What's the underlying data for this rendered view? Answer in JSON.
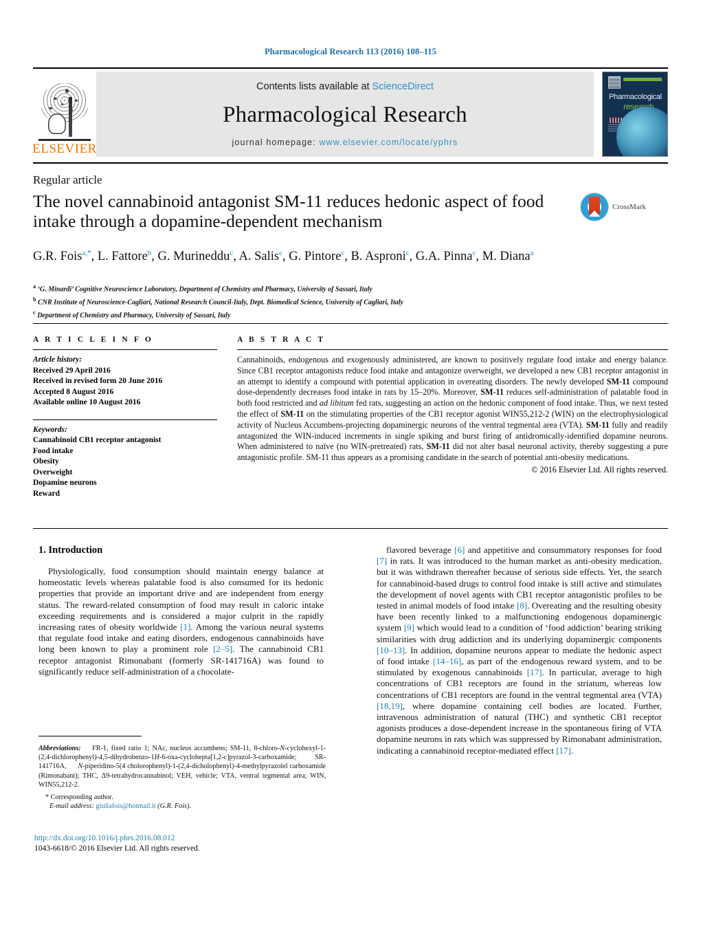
{
  "running_head": "Pharmacological Research 113 (2016) 108–115",
  "masthead": {
    "publisher_name": "ELSEVIER",
    "contents_prefix": "Contents lists available at ",
    "contents_link": "ScienceDirect",
    "journal_title": "Pharmacological Research",
    "homepage_prefix": "journal homepage: ",
    "homepage_url": "www.elsevier.com/locate/yphrs",
    "cover": {
      "line1": "Pharmacological",
      "line2": "research"
    }
  },
  "article": {
    "type": "Regular article",
    "title": "The novel cannabinoid antagonist SM-11 reduces hedonic aspect of food intake through a dopamine-dependent mechanism",
    "crossmark_label": "CrossMark",
    "authors_html": "G.R. Fois<sup>a,*</sup>, L. Fattore<sup>b</sup>, G. Murineddu<sup>c</sup>, A. Salis<sup>c</sup>, G. Pintore<sup>c</sup>, B. Asproni<sup>c</sup>, G.A. Pinna<sup>c</sup>, M. Diana<sup>a</sup>",
    "affiliations": [
      "‘G. Minardi’ Cognitive Neuroscience Laboratory, Department of Chemistry and Pharmacy, University of Sassari, Italy",
      "CNR Institute of Neuroscience-Cagliari, National Research Council-Italy, Dept. Biomedical Science, University of Cagliari, Italy",
      "Department of Chemistry and Pharmacy, University of Sassari, Italy"
    ],
    "affiliation_marks": [
      "a",
      "b",
      "c"
    ]
  },
  "article_info": {
    "heading": "A R T I C L E   I N F O",
    "history_label": "Article history:",
    "history": [
      "Received 29 April 2016",
      "Received in revised form 20 June 2016",
      "Accepted 8 August 2016",
      "Available online 10 August 2016"
    ],
    "keywords_label": "Keywords:",
    "keywords": [
      "Cannabinoid CB1 receptor antagonist",
      "Food intake",
      "Obesity",
      "Overweight",
      "Dopamine neurons",
      "Reward"
    ]
  },
  "abstract": {
    "heading": "A B S T R A C T",
    "body_html": "Cannabinoids, endogenous and exogenously administered, are known to positively regulate food intake and energy balance. Since CB1 receptor antagonists reduce food intake and antagonize overweight, we developed a new CB1 receptor antagonist in an attempt to identify a compound with potential application in overeating disorders. The newly developed <b>SM-11</b> compound dose-dependently decreases food intake in rats by 15&ndash;20%. Moreover, <b>SM-11</b> reduces self-administration of palatable food in both food restricted and <i>ad libitum</i> fed rats, suggesting an action on the hedonic component of food intake. Thus, we next tested the effect of <b>SM-11</b> on the stimulating properties of the CB1 receptor agonist WIN55,212-2 (WIN) on the electrophysiological activity of Nucleus Accumbens-projecting dopaminergic neurons of the ventral tegmental area (VTA). <b>SM-11</b> fully and readily antagonized the WIN-induced increments in single spiking and burst firing of antidromically-identified dopamine neurons. When administered to na&iuml;ve (no WIN-pretreated) rats, <b>SM-11</b> did not alter basal neuronal activity, thereby suggesting a pure antagonistic profile. SM-11 thus appears as a promising candidate in the search of potential anti-obesity medications.",
    "copyright": "© 2016 Elsevier Ltd. All rights reserved."
  },
  "body": {
    "section_number_title": "1. Introduction",
    "left_paragraph_html": "Physiologically, food consumption should maintain energy balance at homeostatic levels whereas palatable food is also consumed for its hedonic properties that provide an important drive and are independent from energy status. The reward-related consumption of food may result in caloric intake exceeding requirements and is considered a major culprit in the rapidly increasing rates of obesity worldwide <span class=\"ref\">[1]</span>. Among the various neural systems that regulate food intake and eating disorders, endogenous cannabinoids have long been known to play a prominent role <span class=\"ref\">[2&ndash;5]</span>. The cannabinoid CB1 receptor antagonist Rimonabant (formerly SR-141716A) was found to significantly reduce self-administration of a chocolate-",
    "right_paragraph_html": "flavored beverage <span class=\"ref\">[6]</span> and appetitive and consummatory responses for food <span class=\"ref\">[7]</span> in rats. It was introduced to the human market as anti-obesity medication, but it was withdrawn thereafter because of serious side effects. Yet, the search for cannabinoid-based drugs to control food intake is still active and stimulates the development of novel agents with CB1 receptor antagonistic profiles to be tested in animal models of food intake <span class=\"ref\">[8]</span>. Overeating and the resulting obesity have been recently linked to a malfunctioning endogenous dopaminergic system <span class=\"ref\">[9]</span> which would lead to a condition of &lsquo;food addiction&rsquo; bearing striking similarities with drug addiction and its underlying dopaminergic components <span class=\"ref\">[10&ndash;13]</span>. In addition, dopamine neurons appear to mediate the hedonic aspect of food intake <span class=\"ref\">[14&ndash;16]</span>, as part of the endogenous reward system, and to be stimulated by exogenous cannabinoids <span class=\"ref\">[17]</span>. In particular, average to high concentrations of CB1 receptors are found in the striatum, whereas low concentrations of CB1 receptors are found in the ventral tegmental area (VTA) <span class=\"ref\">[18,19]</span>, where dopamine containing cell bodies are located. Further, intravenous administration of natural (THC) and synthetic CB1 receptor agonists produces a dose-dependent increase in the spontaneous firing of VTA dopamine neurons in rats which was suppressed by Rimonabant administration, indicating a cannabinoid receptor-mediated effect <span class=\"ref\">[17]</span>."
  },
  "footnote": {
    "abbreviations_html": "<span class=\"ab\">Abbreviations:</span>&nbsp;&nbsp;&nbsp; FR-1, fixed ratio 1; NAc, nucleus accumbens; SM-11, 8-chloro-<span class=\"it\">N</span>-cyclohexyl-1-(2,4-dichlorophenyl)-4,5-dihydrobenzo-1<span class=\"it\">H</span>-6-oxa-cyclohepta[1,2-c]pyrazol-3-carboxamide;&nbsp;&nbsp;&nbsp;&nbsp; SR-141716A,&nbsp;&nbsp;&nbsp;&nbsp;&nbsp; <span class=\"it\">N</span>-piperidino-5(4 cholorophenyl)-1-(2,4-dicholophenyl)-4-methylpyrazolel carboxamide (Rimonabant); THC, &Delta;9-tetrahydrocannabinol; VEH, vehicle; VTA, ventral tegmental area; WIN, WIN55,212-2.",
    "corresponding": "* Corresponding author.",
    "email_label": "E-mail address:",
    "email": "giuliafois@hotmail.it",
    "email_suffix": "(G.R. Fois)."
  },
  "doi_footer": {
    "doi_url": "http://dx.doi.org/10.1016/j.phrs.2016.08.012",
    "issn_line": "1043-6618/© 2016 Elsevier Ltd. All rights reserved."
  }
}
